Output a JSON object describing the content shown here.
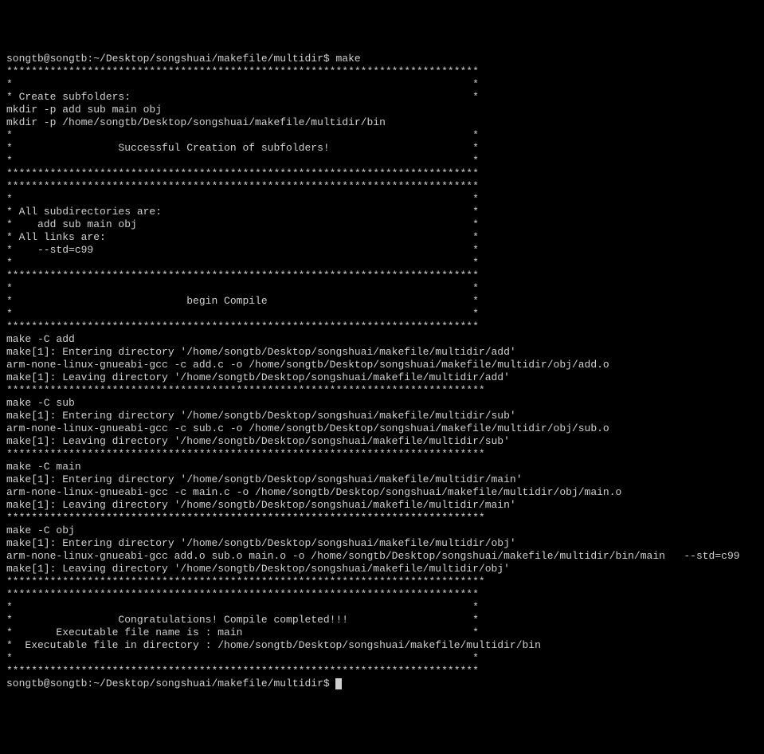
{
  "terminal": {
    "prompt1_user": "songtb@songtb",
    "prompt1_path": ":~/Desktop/songshuai/makefile/multidir$",
    "prompt1_cmd": " make",
    "stars1": "****************************************************************************",
    "star_empty": "*                                                                          *",
    "create_subfolders": "* Create subfolders:                                                       *",
    "mkdir1": "mkdir -p add sub main obj",
    "mkdir2": "mkdir -p /home/songtb/Desktop/songshuai/makefile/multidir/bin",
    "success_msg": "*                 Successful Creation of subfolders!                       *",
    "all_subdirs": "* All subdirectories are:                                                  *",
    "subdirs_list": "*    add sub main obj                                                      *",
    "all_links": "* All links are:                                                           *",
    "links_list": "*    --std=c99                                                             *",
    "begin_compile": "*                            begin Compile                                 *",
    "make_add": "make -C add",
    "make1_enter_add": "make[1]: Entering directory '/home/songtb/Desktop/songshuai/makefile/multidir/add'",
    "gcc_add": "arm-none-linux-gnueabi-gcc -c add.c -o /home/songtb/Desktop/songshuai/makefile/multidir/obj/add.o",
    "make1_leave_add": "make[1]: Leaving directory '/home/songtb/Desktop/songshuai/makefile/multidir/add'",
    "stars_short": "*****************************************************************************",
    "make_sub": "make -C sub",
    "make1_enter_sub": "make[1]: Entering directory '/home/songtb/Desktop/songshuai/makefile/multidir/sub'",
    "gcc_sub": "arm-none-linux-gnueabi-gcc -c sub.c -o /home/songtb/Desktop/songshuai/makefile/multidir/obj/sub.o",
    "make1_leave_sub": "make[1]: Leaving directory '/home/songtb/Desktop/songshuai/makefile/multidir/sub'",
    "make_main": "make -C main",
    "make1_enter_main": "make[1]: Entering directory '/home/songtb/Desktop/songshuai/makefile/multidir/main'",
    "gcc_main": "arm-none-linux-gnueabi-gcc -c main.c -o /home/songtb/Desktop/songshuai/makefile/multidir/obj/main.o",
    "make1_leave_main": "make[1]: Leaving directory '/home/songtb/Desktop/songshuai/makefile/multidir/main'",
    "make_obj": "make -C obj",
    "make1_enter_obj": "make[1]: Entering directory '/home/songtb/Desktop/songshuai/makefile/multidir/obj'",
    "gcc_link": "arm-none-linux-gnueabi-gcc add.o sub.o main.o -o /home/songtb/Desktop/songshuai/makefile/multidir/bin/main   --std=c99",
    "make1_leave_obj": "make[1]: Leaving directory '/home/songtb/Desktop/songshuai/makefile/multidir/obj'",
    "congrats": "*                 Congratulations! Compile completed!!!                    *",
    "exe_name": "*       Executable file name is : main                                     *",
    "exe_dir": "*  Executable file in directory : /home/songtb/Desktop/songshuai/makefile/multidir/bin",
    "prompt2_user": "songtb@songtb",
    "prompt2_path": ":~/Desktop/songshuai/makefile/multidir$",
    "prompt2_cmd": " "
  }
}
